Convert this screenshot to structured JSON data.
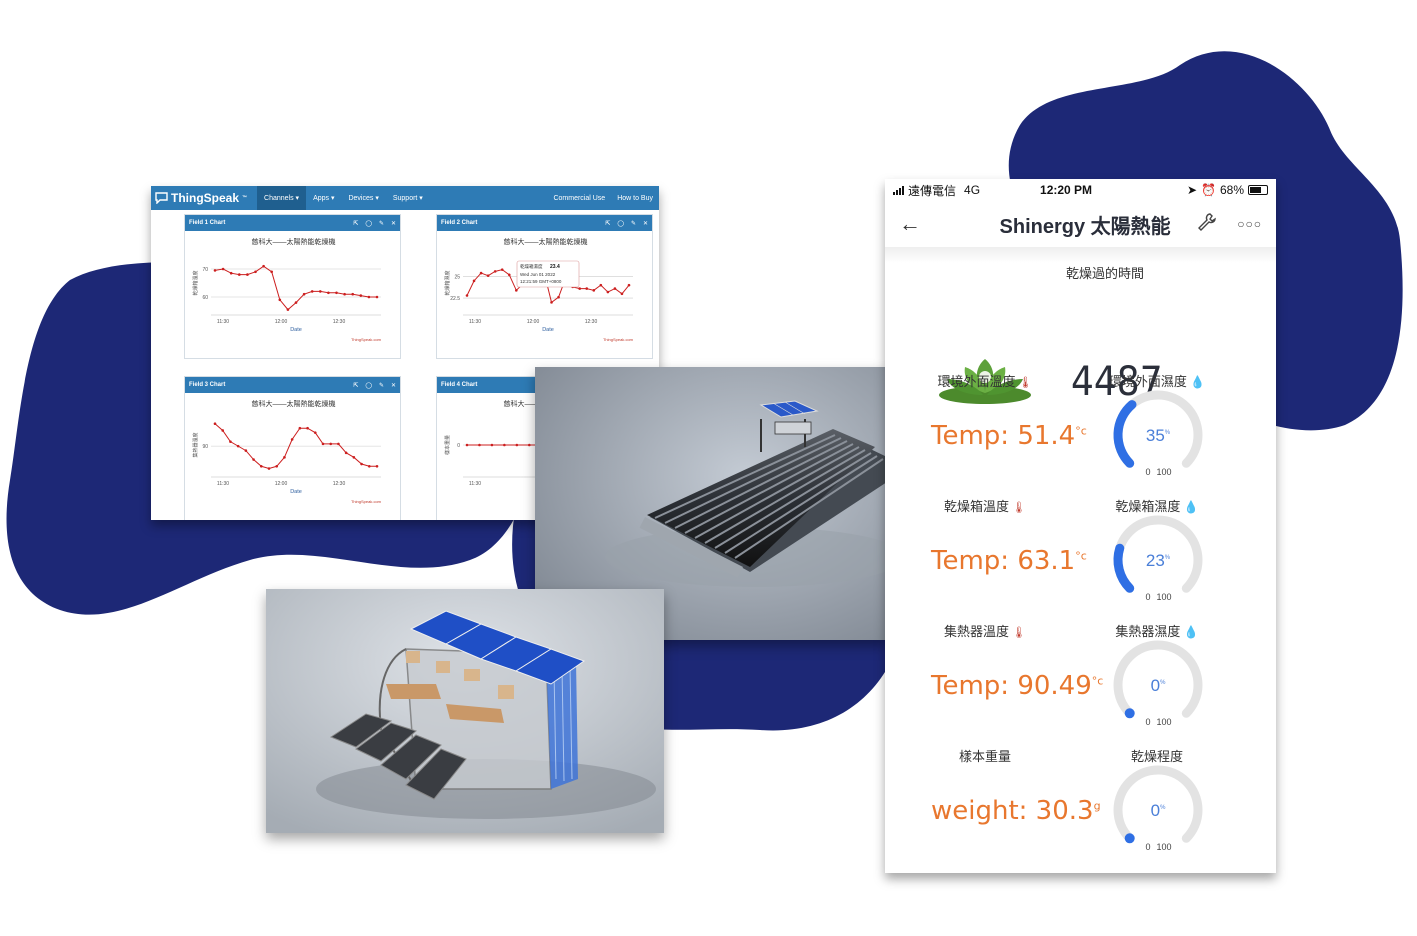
{
  "colors": {
    "blob": "#1d2876",
    "ts_blue": "#2e7bb5",
    "chart_line": "#cc1f1f",
    "temp_orange": "#e8772e",
    "gauge_blue": "#2f6fe4",
    "gauge_track": "#e3e3e3"
  },
  "thingspeak": {
    "logo": "ThingSpeak",
    "trademark": "™",
    "nav": {
      "channels": "Channels ▾",
      "apps": "Apps ▾",
      "devices": "Devices ▾",
      "support": "Support ▾",
      "commercial": "Commercial Use",
      "how_to_buy": "How to Buy"
    },
    "cards": [
      {
        "title": "Field 1 Chart",
        "chart_title": "慈科大——太陽熱能乾燥機",
        "ylabel": "乾燥箱溫度",
        "xlabel": "Date",
        "credit": "ThingSpeak.com",
        "xticks": [
          "11:30",
          "12:00",
          "12:30"
        ],
        "yticks": [
          "70",
          "60"
        ],
        "ylim": [
          55,
          75
        ],
        "values": [
          69.5,
          70,
          68.5,
          68,
          68,
          69,
          71,
          69,
          59,
          55.5,
          58,
          61,
          62,
          62,
          61.5,
          61.5,
          61,
          61,
          60.5,
          60,
          60
        ]
      },
      {
        "title": "Field 2 Chart",
        "chart_title": "慈科大——太陽熱能乾燥機",
        "ylabel": "乾燥箱濕度",
        "xlabel": "Date",
        "credit": "ThingSpeak.com",
        "xticks": [
          "11:30",
          "12:00",
          "12:30"
        ],
        "yticks": [
          "25",
          "22.5"
        ],
        "ylim": [
          21,
          27.5
        ],
        "values": [
          22.8,
          24.5,
          25.4,
          25.1,
          25.6,
          25.8,
          25.2,
          23.4,
          24.2,
          25.2,
          26.5,
          25.3,
          22,
          22.6,
          24.8,
          23.8,
          23.6,
          23.6,
          23.4,
          24,
          23.2,
          23.6,
          23,
          24
        ],
        "tooltip": {
          "line1": "乾燥箱濕度",
          "value": "23.4",
          "line2": "Wed Jun 01 2022",
          "line3": "12:21:59 GMT+0800"
        }
      },
      {
        "title": "Field 3 Chart",
        "chart_title": "慈科大——太陽熱能乾燥機",
        "ylabel": "集熱器溫度",
        "xlabel": "Date",
        "credit": "ThingSpeak.com",
        "xticks": [
          "11:30",
          "12:00",
          "12:30"
        ],
        "yticks": [
          "90"
        ],
        "ylim": [
          84,
          96.5
        ],
        "values": [
          95,
          93.5,
          91,
          90,
          89,
          87,
          85.5,
          85,
          85.5,
          87.5,
          91.5,
          94,
          94,
          93,
          90.5,
          90.5,
          90.5,
          88.5,
          87.5,
          86,
          85.5,
          85.5
        ]
      },
      {
        "title": "Field 4 Chart",
        "chart_title": "慈科大——太陽熱能乾燥機",
        "ylabel": "樣本重量",
        "xlabel": "Date",
        "credit": "ThingSpeak.com",
        "xticks": [
          "11:30"
        ],
        "yticks": [
          "0"
        ],
        "ylim": [
          -5,
          5
        ],
        "values": [
          0,
          0,
          0,
          0,
          0,
          0,
          0,
          0,
          0,
          0,
          0,
          0,
          0,
          0
        ]
      }
    ]
  },
  "app": {
    "status": {
      "carrier": "遠傳電信",
      "network": "4G",
      "time": "12:20 PM",
      "battery": "68%"
    },
    "title": "Shinergy 太陽熱能",
    "back": "←",
    "wrench": "🔧",
    "more": "○○○",
    "drying_time_label": "乾燥過的時間",
    "drying_time_value": "4487",
    "sections": [
      {
        "left_label": "環境外面溫度",
        "right_label": "環境外面濕度",
        "temp_prefix": "Temp: ",
        "temp_value": "51.4",
        "temp_unit": "°c",
        "gauge_value": 35,
        "gauge_text": "35",
        "gauge_unit": "%"
      },
      {
        "left_label": "乾燥箱溫度",
        "right_label": "乾燥箱濕度",
        "temp_prefix": "Temp: ",
        "temp_value": "63.1",
        "temp_unit": "°c",
        "gauge_value": 23,
        "gauge_text": "23",
        "gauge_unit": "%"
      },
      {
        "left_label": "集熱器溫度",
        "right_label": "集熱器濕度",
        "temp_prefix": "Temp: ",
        "temp_value": "90.49",
        "temp_unit": "°c",
        "gauge_value": 0,
        "gauge_text": "0",
        "gauge_unit": "%"
      },
      {
        "left_label": "樣本重量",
        "right_label": "乾燥程度",
        "temp_prefix": "weight: ",
        "temp_value": "30.3",
        "temp_unit": "g",
        "gauge_value": 0,
        "gauge_text": "0",
        "gauge_unit": "%"
      }
    ],
    "gauge_min": "0",
    "gauge_max": "100"
  }
}
